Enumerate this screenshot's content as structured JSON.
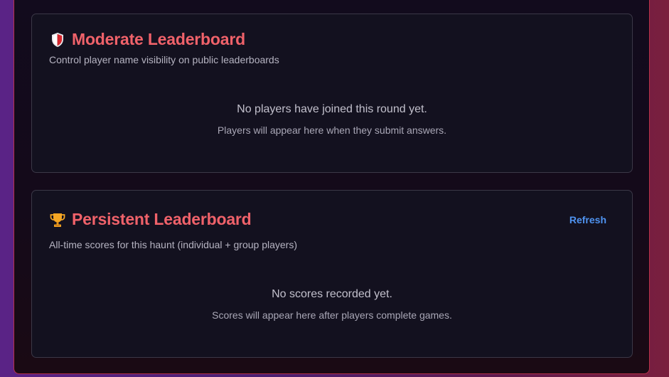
{
  "moderate_card": {
    "icon": "shield-icon",
    "title": "Moderate Leaderboard",
    "subtitle": "Control player name visibility on public leaderboards",
    "empty_title": "No players have joined this round yet.",
    "empty_description": "Players will appear here when they submit answers."
  },
  "persistent_card": {
    "icon": "trophy-icon",
    "title": "Persistent Leaderboard",
    "subtitle": "All-time scores for this haunt (individual + group players)",
    "refresh_label": "Refresh",
    "empty_title": "No scores recorded yet.",
    "empty_description": "Scores will appear here after players complete games."
  },
  "colors": {
    "accent_title": "#f0626a",
    "link_blue": "#4f93f0",
    "panel_border": "#b8324a"
  }
}
